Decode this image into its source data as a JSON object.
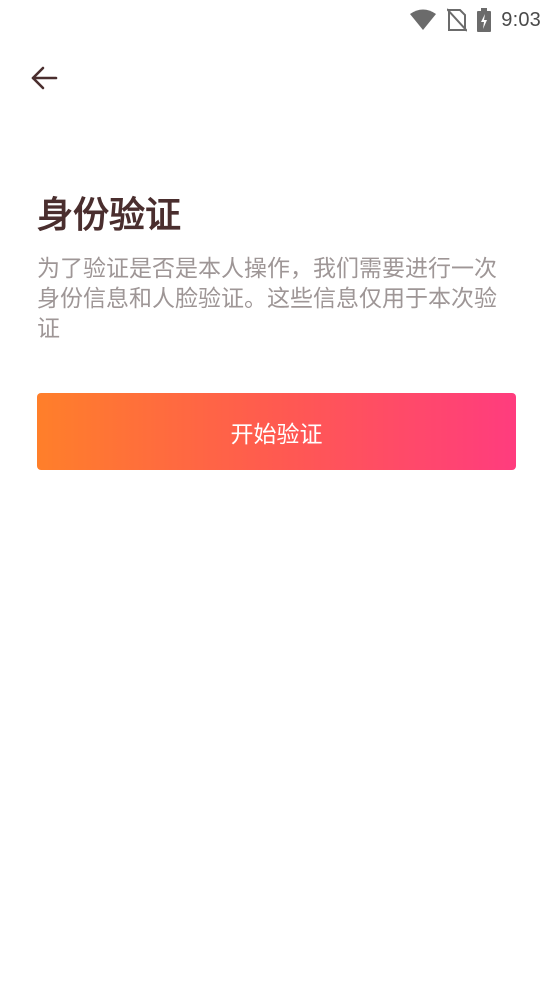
{
  "status_bar": {
    "time": "9:03",
    "icons": [
      "wifi-icon",
      "no-sim-icon",
      "battery-charging-icon"
    ]
  },
  "header": {
    "back_icon": "back-arrow-icon"
  },
  "main": {
    "title": "身份验证",
    "description": "为了验证是否是本人操作，我们需要进行一次身份信息和人脸验证。这些信息仅用于本次验证",
    "start_button_label": "开始验证"
  },
  "colors": {
    "title": "#4a2e2e",
    "description": "#9e9696",
    "button_gradient_start": "#ff7f2a",
    "button_gradient_end": "#ff3c7e",
    "button_text": "#ffffff"
  }
}
